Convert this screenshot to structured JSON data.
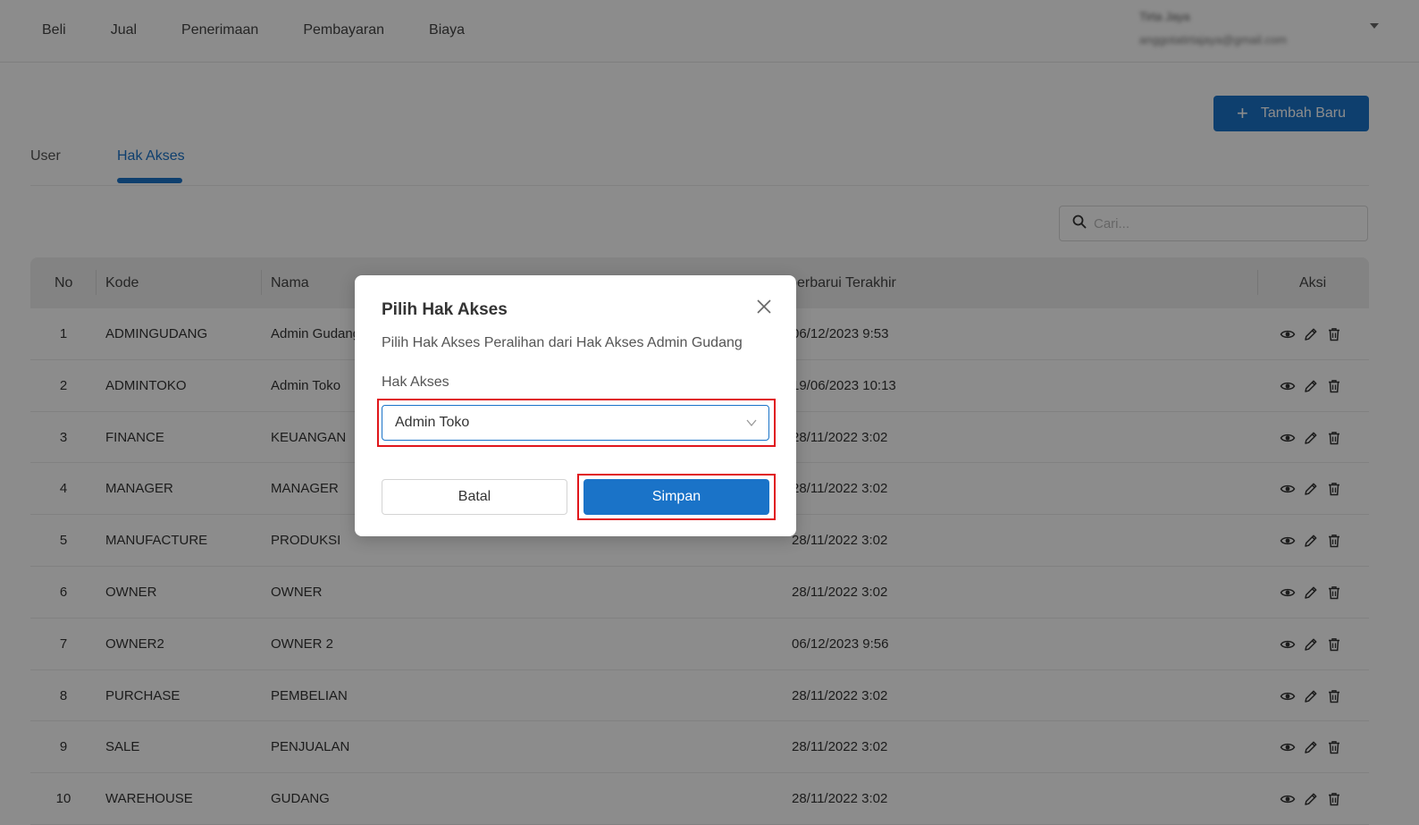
{
  "nav": {
    "items": [
      {
        "label": "Beli"
      },
      {
        "label": "Jual"
      },
      {
        "label": "Penerimaan"
      },
      {
        "label": "Pembayaran"
      },
      {
        "label": "Biaya"
      }
    ]
  },
  "user": {
    "name": "Tirta Jaya",
    "email": "anggotatirtajaya@gmail.com"
  },
  "toolbar": {
    "add_plus": "+",
    "add_label": "Tambah Baru"
  },
  "tabs": [
    {
      "label": "User",
      "active": false
    },
    {
      "label": "Hak Akses",
      "active": true
    }
  ],
  "search": {
    "placeholder": "Cari..."
  },
  "table": {
    "headers": {
      "no": "No",
      "kode": "Kode",
      "nama": "Nama",
      "updated": "Diperbarui Terakhir",
      "aksi": "Aksi"
    },
    "rows": [
      {
        "no": "1",
        "kode": "ADMINGUDANG",
        "nama": "Admin Gudang",
        "updated": "06/12/2023 9:53"
      },
      {
        "no": "2",
        "kode": "ADMINTOKO",
        "nama": "Admin Toko",
        "updated": "19/06/2023 10:13"
      },
      {
        "no": "3",
        "kode": "FINANCE",
        "nama": "KEUANGAN",
        "updated": "28/11/2022 3:02"
      },
      {
        "no": "4",
        "kode": "MANAGER",
        "nama": "MANAGER",
        "updated": "28/11/2022 3:02"
      },
      {
        "no": "5",
        "kode": "MANUFACTURE",
        "nama": "PRODUKSI",
        "updated": "28/11/2022 3:02"
      },
      {
        "no": "6",
        "kode": "OWNER",
        "nama": "OWNER",
        "updated": "28/11/2022 3:02"
      },
      {
        "no": "7",
        "kode": "OWNER2",
        "nama": "OWNER 2",
        "updated": "06/12/2023 9:56"
      },
      {
        "no": "8",
        "kode": "PURCHASE",
        "nama": "PEMBELIAN",
        "updated": "28/11/2022 3:02"
      },
      {
        "no": "9",
        "kode": "SALE",
        "nama": "PENJUALAN",
        "updated": "28/11/2022 3:02"
      },
      {
        "no": "10",
        "kode": "WAREHOUSE",
        "nama": "GUDANG",
        "updated": "28/11/2022 3:02"
      }
    ]
  },
  "modal": {
    "title": "Pilih Hak Akses",
    "description": "Pilih Hak Akses Peralihan dari Hak Akses Admin Gudang",
    "field_label": "Hak Akses",
    "selected_value": "Admin Toko",
    "cancel_label": "Batal",
    "save_label": "Simpan"
  },
  "colors": {
    "accent": "#1a73c8",
    "highlight": "#e0161b"
  }
}
